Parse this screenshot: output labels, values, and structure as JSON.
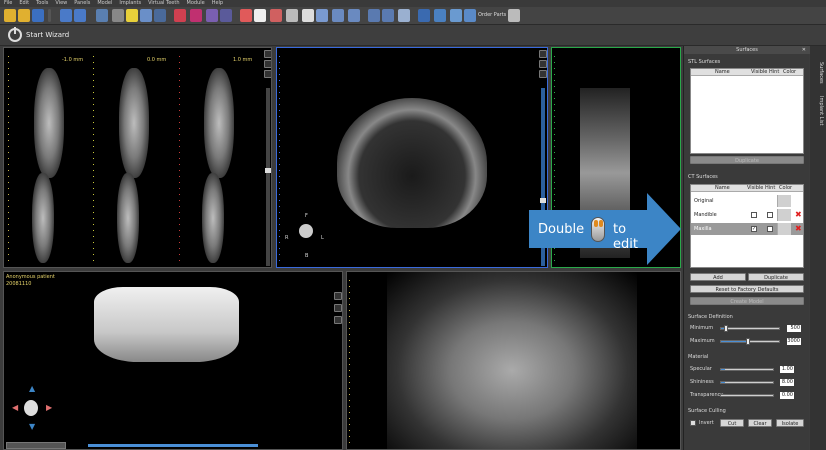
{
  "menu": [
    "File",
    "Edit",
    "Tools",
    "View",
    "Panels",
    "Model",
    "Implants",
    "Virtual Teeth",
    "Module",
    "Help"
  ],
  "toolbar": {
    "order_parts_label": "Order Parts"
  },
  "wizard": {
    "label": "Start Wizard"
  },
  "viewports": {
    "slice1_label": "-1.0 mm",
    "slice2_label": "0.0 mm",
    "slice3_label": "1.0 mm",
    "patient_name": "Anonymous patient",
    "patient_date": "20081110",
    "axial_orient": {
      "top": "F",
      "left": "R",
      "right": "L",
      "bottom": "B"
    }
  },
  "callout": {
    "word1": "Double",
    "word2": "to edit"
  },
  "panel": {
    "title": "Surfaces",
    "stl": {
      "title": "STL Surfaces",
      "columns": [
        "Name",
        "Visible",
        "Hint",
        "Color"
      ],
      "duplicate_label": "Duplicate"
    },
    "ct": {
      "title": "CT Surfaces",
      "columns": [
        "Name",
        "Visible",
        "Hint",
        "Color"
      ],
      "rows": [
        {
          "name": "Original",
          "visible": false,
          "hint": false
        },
        {
          "name": "Mandible",
          "visible": false,
          "hint": false
        },
        {
          "name": "Maxilla",
          "visible": true,
          "hint": false
        }
      ],
      "add_label": "Add",
      "duplicate_label": "Duplicate",
      "reset_label": "Reset to Factory Defaults",
      "create_model_label": "Create Model"
    },
    "surface_definition": {
      "title": "Surface Definition",
      "minimum_label": "Minimum",
      "minimum_value": "500",
      "minimum_fraction": 0.1,
      "maximum_label": "Maximum",
      "maximum_value": "3000",
      "maximum_fraction": 0.47
    },
    "material": {
      "title": "Material",
      "specular_label": "Specular",
      "specular_value": "1.00",
      "shininess_label": "Shininess",
      "shininess_value": "8.00",
      "transparency_label": "Transparency",
      "transparency_value": "0.00"
    },
    "culling": {
      "title": "Surface Culling",
      "invert_label": "Invert",
      "cut_label": "Cut",
      "clear_label": "Clear",
      "isolate_label": "Isolate"
    }
  },
  "sidetabs": {
    "surfaces": "Surfaces",
    "implant_list": "Implant List"
  },
  "colors": {
    "accent": "#3c85c6",
    "slider": "#2b5f9e",
    "delete": "#e02020"
  }
}
